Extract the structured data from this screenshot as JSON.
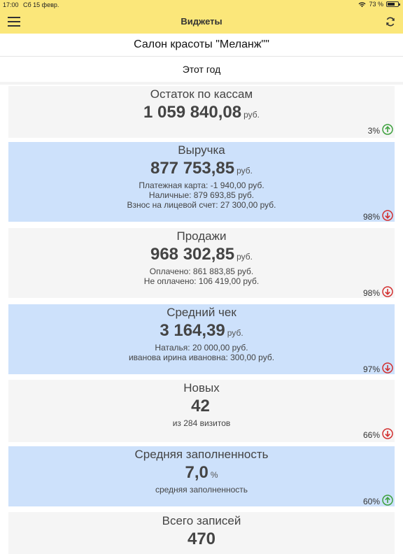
{
  "status": {
    "time": "17:00",
    "date": "Сб 15 февр.",
    "battery": "73 %",
    "battery_level": 0.73
  },
  "nav": {
    "title": "Виджеты"
  },
  "salon": "Салон красоты \"Меланж\"\"",
  "period": "Этот год",
  "colors": {
    "bar": "#fbe77a",
    "card_grey": "#f5f5f5",
    "card_blue": "#cde1fb",
    "up": "#3da13d",
    "down": "#d33030"
  },
  "widgets": [
    {
      "title": "Остаток по кассам",
      "value": "1 059 840,08",
      "unit": "руб.",
      "details": [],
      "percent": "3%",
      "trend": "up"
    },
    {
      "title": "Выручка",
      "value": "877 753,85",
      "unit": "руб.",
      "details": [
        "Платежная карта: -1 940,00 руб.",
        "Наличные: 879 693,85 руб.",
        "Взнос на лицевой счет: 27 300,00 руб."
      ],
      "percent": "98%",
      "trend": "down"
    },
    {
      "title": "Продажи",
      "value": "968 302,85",
      "unit": "руб.",
      "details": [
        "Оплачено: 861 883,85 руб.",
        "Не оплачено: 106 419,00 руб."
      ],
      "percent": "98%",
      "trend": "down"
    },
    {
      "title": "Средний чек",
      "value": "3 164,39",
      "unit": "руб.",
      "details": [
        "Наталья: 20 000,00 руб.",
        "иванова ирина ивановна: 300,00 руб."
      ],
      "percent": "97%",
      "trend": "down"
    },
    {
      "title": "Новых",
      "value": "42",
      "unit": "",
      "details": [
        "из 284 визитов"
      ],
      "percent": "66%",
      "trend": "down"
    },
    {
      "title": "Средняя заполненность",
      "value": "7,0",
      "unit": "%",
      "details": [
        "средняя заполненность"
      ],
      "percent": "60%",
      "trend": "up"
    },
    {
      "title": "Всего записей",
      "value": "470",
      "unit": "",
      "details": [],
      "percent": "",
      "trend": ""
    }
  ]
}
